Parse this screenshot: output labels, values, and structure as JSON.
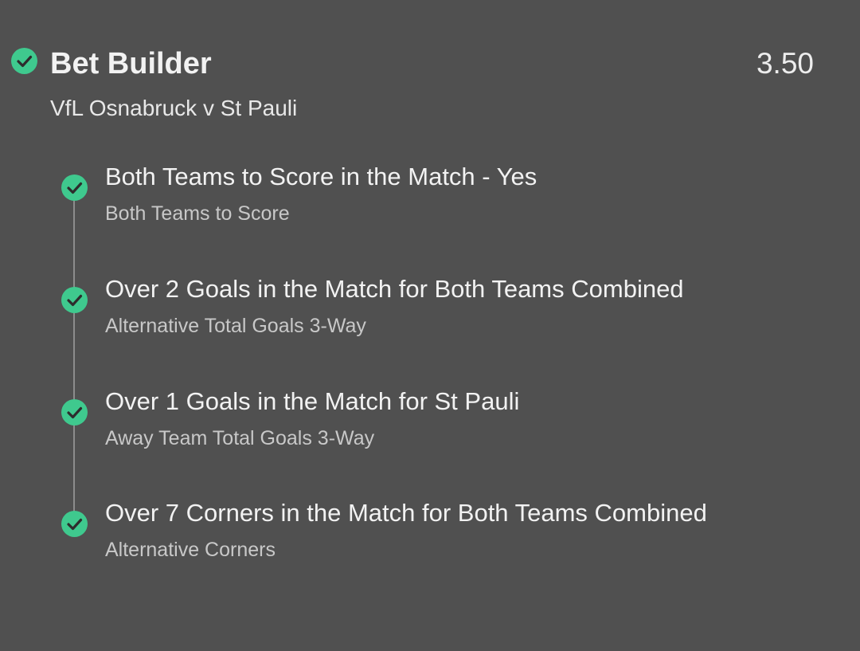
{
  "bet": {
    "title": "Bet Builder",
    "odds": "3.50",
    "match": "VfL Osnabruck v St Pauli",
    "status_icon": "check-circle-icon"
  },
  "legs": [
    {
      "selection": "Both Teams to Score in the Match - Yes",
      "market": "Both Teams to Score",
      "status_icon": "check-circle-icon"
    },
    {
      "selection": "Over 2 Goals in the Match for Both Teams Combined",
      "market": "Alternative Total Goals 3-Way",
      "status_icon": "check-circle-icon"
    },
    {
      "selection": "Over 1 Goals in the Match for St Pauli",
      "market": "Away Team Total Goals 3-Way",
      "status_icon": "check-circle-icon"
    },
    {
      "selection": "Over 7 Corners in the Match for Both Teams Combined",
      "market": "Alternative Corners",
      "status_icon": "check-circle-icon"
    }
  ],
  "colors": {
    "background": "#505050",
    "success": "#3fc98e",
    "text_primary": "#f2f2f2",
    "text_secondary": "#c8c8c8",
    "timeline": "#8c8c8c"
  }
}
